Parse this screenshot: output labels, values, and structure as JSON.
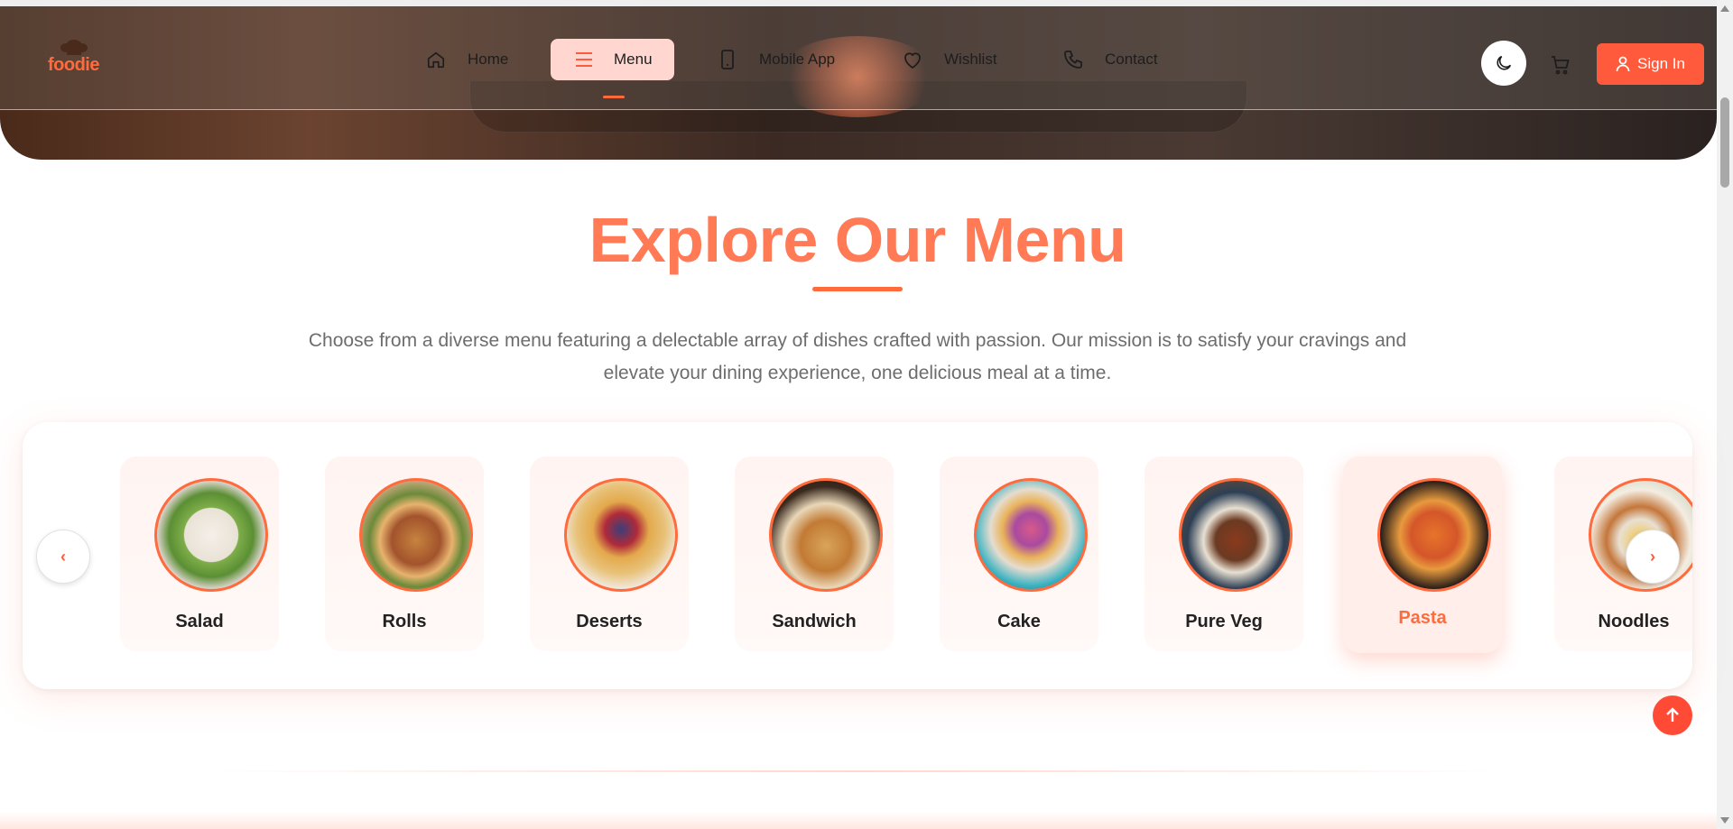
{
  "header": {
    "logo_text": "foodie",
    "nav": [
      {
        "label": "Home",
        "icon": "home-icon"
      },
      {
        "label": "Menu",
        "icon": "menu-icon",
        "active": true
      },
      {
        "label": "Mobile App",
        "icon": "mobile-icon"
      },
      {
        "label": "Wishlist",
        "icon": "heart-icon"
      },
      {
        "label": "Contact",
        "icon": "phone-icon"
      }
    ],
    "theme_icon": "moon-icon",
    "cart_icon": "cart-icon",
    "signin_label": "Sign In",
    "signin_icon": "user-icon"
  },
  "section": {
    "title": "Explore Our Menu",
    "subtitle_line1": "Choose from a diverse menu featuring a delectable array of dishes crafted with passion. Our mission is to satisfy your cravings and",
    "subtitle_line2": "elevate your dining experience, one delicious meal at a time."
  },
  "categories": [
    {
      "name": "Salad"
    },
    {
      "name": "Rolls"
    },
    {
      "name": "Deserts"
    },
    {
      "name": "Sandwich"
    },
    {
      "name": "Cake"
    },
    {
      "name": "Pure Veg"
    },
    {
      "name": "Pasta",
      "active": true
    },
    {
      "name": "Noodles"
    }
  ],
  "carousel": {
    "prev_label": "‹",
    "next_label": "›"
  },
  "colors": {
    "accent": "#ff6b3d",
    "button": "#ff5a3c",
    "active_nav_bg": "#ffd6d0"
  }
}
